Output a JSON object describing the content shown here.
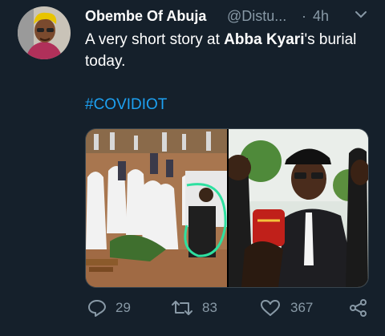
{
  "tweet": {
    "author": {
      "display_name": "Obembe Of Abuja",
      "handle": "@Distu...",
      "separator": "·",
      "time": "4h"
    },
    "text_parts": [
      "A very short story at ",
      "Abba Kyari",
      "'s burial today."
    ],
    "hashtag": "#COVIDIOT",
    "media": [
      {
        "description": "burial-scene-photo"
      },
      {
        "description": "pallbearer-photo"
      }
    ],
    "stats": {
      "replies": "29",
      "retweets": "83",
      "likes": "367"
    }
  },
  "icons": [
    "caret-down-icon",
    "reply-icon",
    "retweet-icon",
    "like-icon",
    "share-icon"
  ],
  "colors": {
    "background": "#15202b",
    "text": "#ffffff",
    "muted": "#8899a6",
    "link": "#1da1f2"
  }
}
